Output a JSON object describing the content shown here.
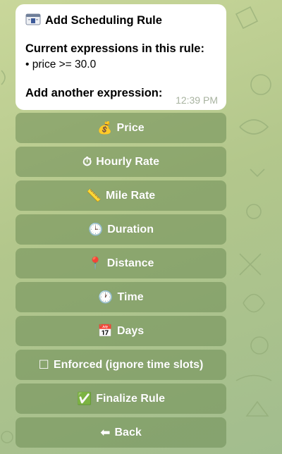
{
  "message": {
    "title": "Add Scheduling Rule",
    "title_icon": "calendar-card-icon",
    "subtitle": "Current expressions in this rule:",
    "expressions": [
      "• price >= 30.0"
    ],
    "add_prompt": "Add another expression:",
    "time": "12:39 PM"
  },
  "keyboard": {
    "buttons": [
      {
        "icon": "money-bag-icon",
        "glyph": "💰",
        "label": "Price"
      },
      {
        "icon": "stopwatch-icon",
        "glyph": "⏱",
        "label": "Hourly Rate"
      },
      {
        "icon": "ruler-icon",
        "glyph": "📏",
        "label": "Mile Rate"
      },
      {
        "icon": "clock-icon",
        "glyph": "🕒",
        "label": "Duration"
      },
      {
        "icon": "pin-icon",
        "glyph": "📍",
        "label": "Distance"
      },
      {
        "icon": "clock-icon",
        "glyph": "🕐",
        "label": "Time"
      },
      {
        "icon": "calendar-icon",
        "glyph": "📅",
        "label": "Days"
      },
      {
        "icon": "checkbox-icon",
        "glyph": "☐",
        "label": "Enforced (ignore time slots)"
      },
      {
        "icon": "check-mark-icon",
        "glyph": "✅",
        "label": "Finalize Rule"
      },
      {
        "icon": "back-arrow-icon",
        "glyph": "⬅",
        "label": "Back"
      }
    ]
  },
  "colors": {
    "background": "#b7c98f",
    "button": "#7d9a63",
    "bubble": "#ffffff",
    "timestamp": "#a8b3a0"
  }
}
